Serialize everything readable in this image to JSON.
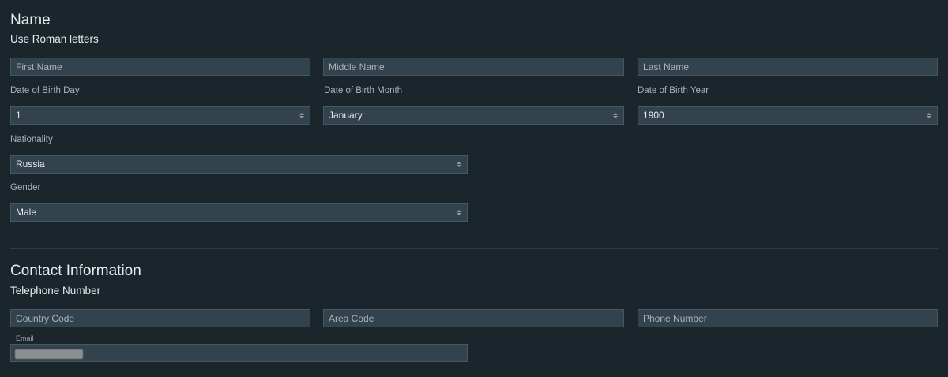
{
  "name_section": {
    "title": "Name",
    "subtitle": "Use Roman letters",
    "first_name_placeholder": "First Name",
    "middle_name_placeholder": "Middle Name",
    "last_name_placeholder": "Last Name",
    "dob_day_label": "Date of Birth Day",
    "dob_day_value": "1",
    "dob_month_label": "Date of Birth Month",
    "dob_month_value": "January",
    "dob_year_label": "Date of Birth Year",
    "dob_year_value": "1900",
    "nationality_label": "Nationality",
    "nationality_value": "Russia",
    "gender_label": "Gender",
    "gender_value": "Male"
  },
  "contact_section": {
    "title": "Contact Information",
    "subtitle": "Telephone Number",
    "country_code_placeholder": "Country Code",
    "area_code_placeholder": "Area Code",
    "phone_number_placeholder": "Phone Number",
    "email_label": "Email"
  },
  "icons": {
    "select_caret": "sort-caret-icon"
  }
}
